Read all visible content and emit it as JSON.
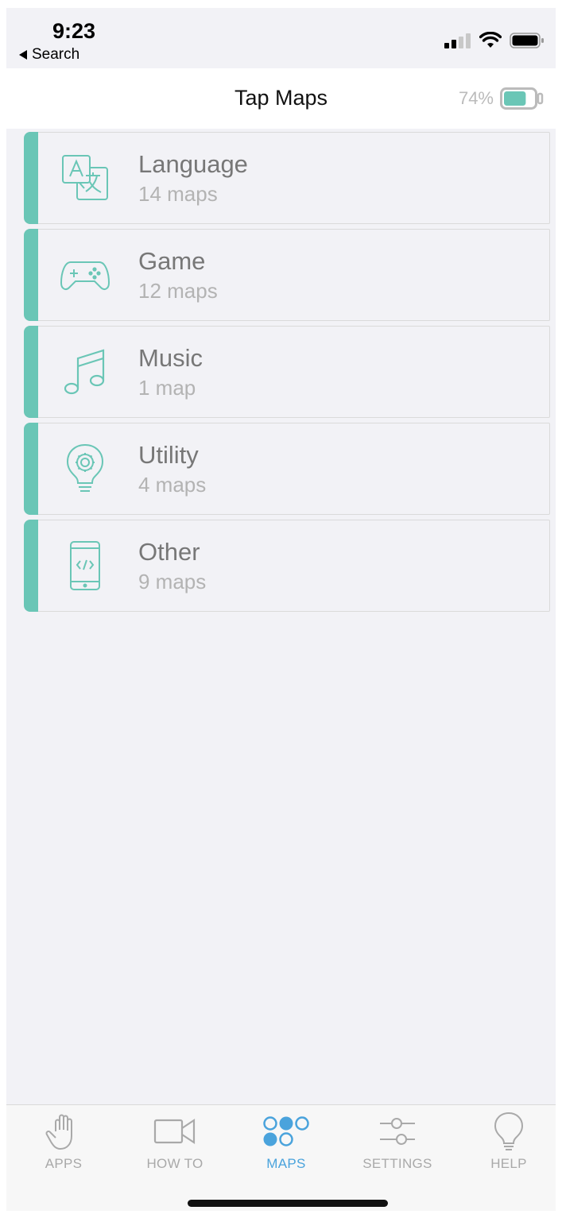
{
  "status_bar": {
    "time": "9:23",
    "back_label": "Search"
  },
  "header": {
    "title": "Tap Maps",
    "battery_percent": "74%",
    "battery_level": 0.74
  },
  "colors": {
    "accent": "#6ac6b6",
    "active_tab": "#4aa3dc",
    "inactive_tab": "#a9a9a9"
  },
  "categories": [
    {
      "name": "Language",
      "count": "14 maps",
      "icon": "translate-icon"
    },
    {
      "name": "Game",
      "count": "12 maps",
      "icon": "gamepad-icon"
    },
    {
      "name": "Music",
      "count": "1 map",
      "icon": "music-note-icon"
    },
    {
      "name": "Utility",
      "count": "4 maps",
      "icon": "lightbulb-gear-icon"
    },
    {
      "name": "Other",
      "count": "9 maps",
      "icon": "phone-code-icon"
    }
  ],
  "tabs": [
    {
      "label": "APPS",
      "icon": "hand-icon",
      "active": false
    },
    {
      "label": "HOW TO",
      "icon": "video-camera-icon",
      "active": false
    },
    {
      "label": "MAPS",
      "icon": "dots-grid-icon",
      "active": true
    },
    {
      "label": "SETTINGS",
      "icon": "sliders-icon",
      "active": false
    },
    {
      "label": "HELP",
      "icon": "lightbulb-icon",
      "active": false
    }
  ]
}
